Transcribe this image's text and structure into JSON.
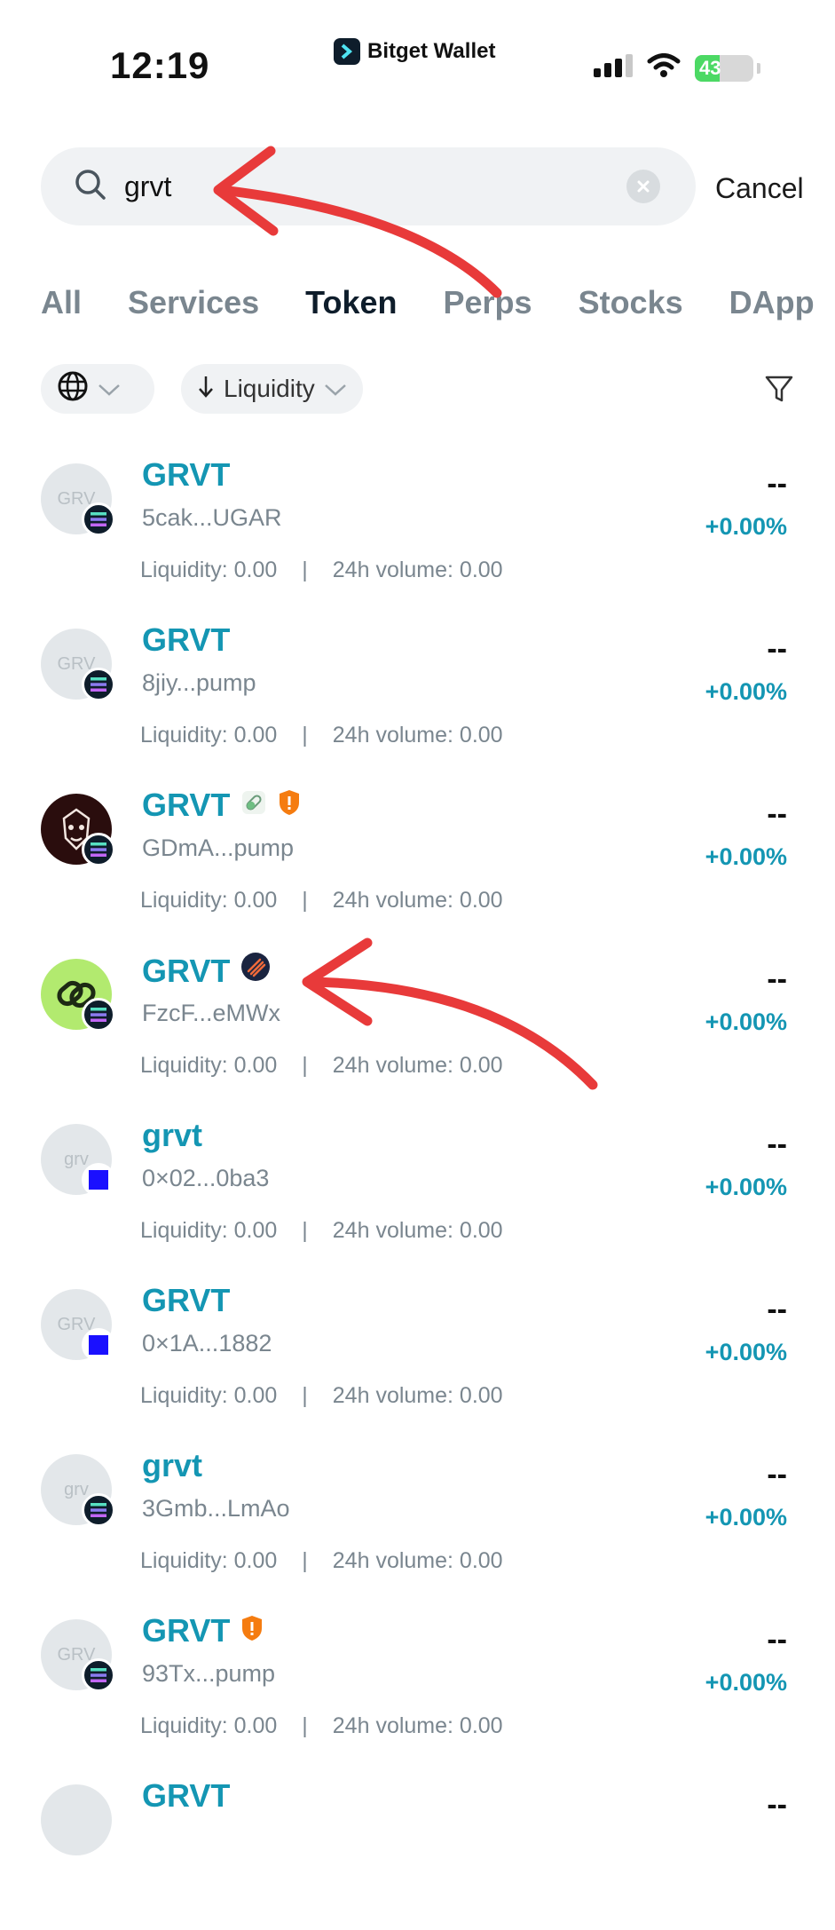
{
  "status_bar": {
    "time": "12:19",
    "brand": "Bitget Wallet",
    "battery": "43",
    "battery_level": 0.43
  },
  "search": {
    "value": "grvt",
    "cancel_label": "Cancel"
  },
  "tabs": [
    {
      "label": "All",
      "active": false
    },
    {
      "label": "Services",
      "active": false
    },
    {
      "label": "Token",
      "active": true
    },
    {
      "label": "Perps",
      "active": false
    },
    {
      "label": "Stocks",
      "active": false
    },
    {
      "label": "DApp",
      "active": false
    }
  ],
  "filters": {
    "sort_label": "Liquidity"
  },
  "tokens": [
    {
      "name": "GRVT",
      "avatar_text": "GRV",
      "address": "5cak...UGAR",
      "liquidity": "Liquidity: 0.00",
      "volume": "24h volume: 0.00",
      "price": "--",
      "change": "+0.00%",
      "chain": "solana-icon"
    },
    {
      "name": "GRVT",
      "avatar_text": "GRV",
      "address": "8jiy...pump",
      "liquidity": "Liquidity: 0.00",
      "volume": "24h volume: 0.00",
      "price": "--",
      "change": "+0.00%",
      "chain": "solana-icon"
    },
    {
      "name": "GRVT",
      "avatar_text": "",
      "address": "GDmA...pump",
      "liquidity": "Liquidity: 0.00",
      "volume": "24h volume: 0.00",
      "price": "--",
      "change": "+0.00%",
      "chain": "solana-icon"
    },
    {
      "name": "GRVT",
      "avatar_text": "",
      "address": "FzcF...eMWx",
      "liquidity": "Liquidity: 0.00",
      "volume": "24h volume: 0.00",
      "price": "--",
      "change": "+0.00%",
      "chain": "solana-icon"
    },
    {
      "name": "grvt",
      "avatar_text": "grv",
      "address": "0×02...0ba3",
      "liquidity": "Liquidity: 0.00",
      "volume": "24h volume: 0.00",
      "price": "--",
      "change": "+0.00%",
      "chain": "base-icon"
    },
    {
      "name": "GRVT",
      "avatar_text": "GRV",
      "address": "0×1A...1882",
      "liquidity": "Liquidity: 0.00",
      "volume": "24h volume: 0.00",
      "price": "--",
      "change": "+0.00%",
      "chain": "base-icon"
    },
    {
      "name": "grvt",
      "avatar_text": "grv",
      "address": "3Gmb...LmAo",
      "liquidity": "Liquidity: 0.00",
      "volume": "24h volume: 0.00",
      "price": "--",
      "change": "+0.00%",
      "chain": "solana-icon"
    },
    {
      "name": "GRVT",
      "avatar_text": "GRV",
      "address": "93Tx...pump",
      "liquidity": "Liquidity: 0.00",
      "volume": "24h volume: 0.00",
      "price": "--",
      "change": "+0.00%",
      "chain": "solana-icon"
    },
    {
      "name": "GRVT",
      "avatar_text": "",
      "address": "",
      "liquidity": "",
      "volume": "",
      "price": "--",
      "change": "",
      "chain": "solana-icon"
    }
  ],
  "colors": {
    "accent": "#1496b3",
    "annotation_arrow": "#e83a3a",
    "base_chain": "#1a10ff"
  }
}
